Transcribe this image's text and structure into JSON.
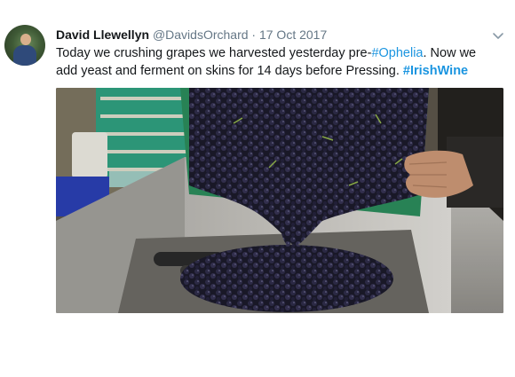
{
  "author": {
    "name": "David Llewellyn",
    "handle": "@DavidsOrchard",
    "separator": "·",
    "date": "17 Oct 2017"
  },
  "tweet": {
    "text_part1": "Today we crushing grapes we harvested yesterday pre-",
    "hashtag1": "#Ophelia",
    "text_part2": ". Now we add yeast and ferment on skins for 14 days before Pressing. ",
    "hashtag2": "#IrishWine"
  },
  "icons": {
    "menu": "chevron-down-icon"
  },
  "colors": {
    "link": "#1b95e0",
    "muted": "#657786",
    "text": "#14171a"
  }
}
